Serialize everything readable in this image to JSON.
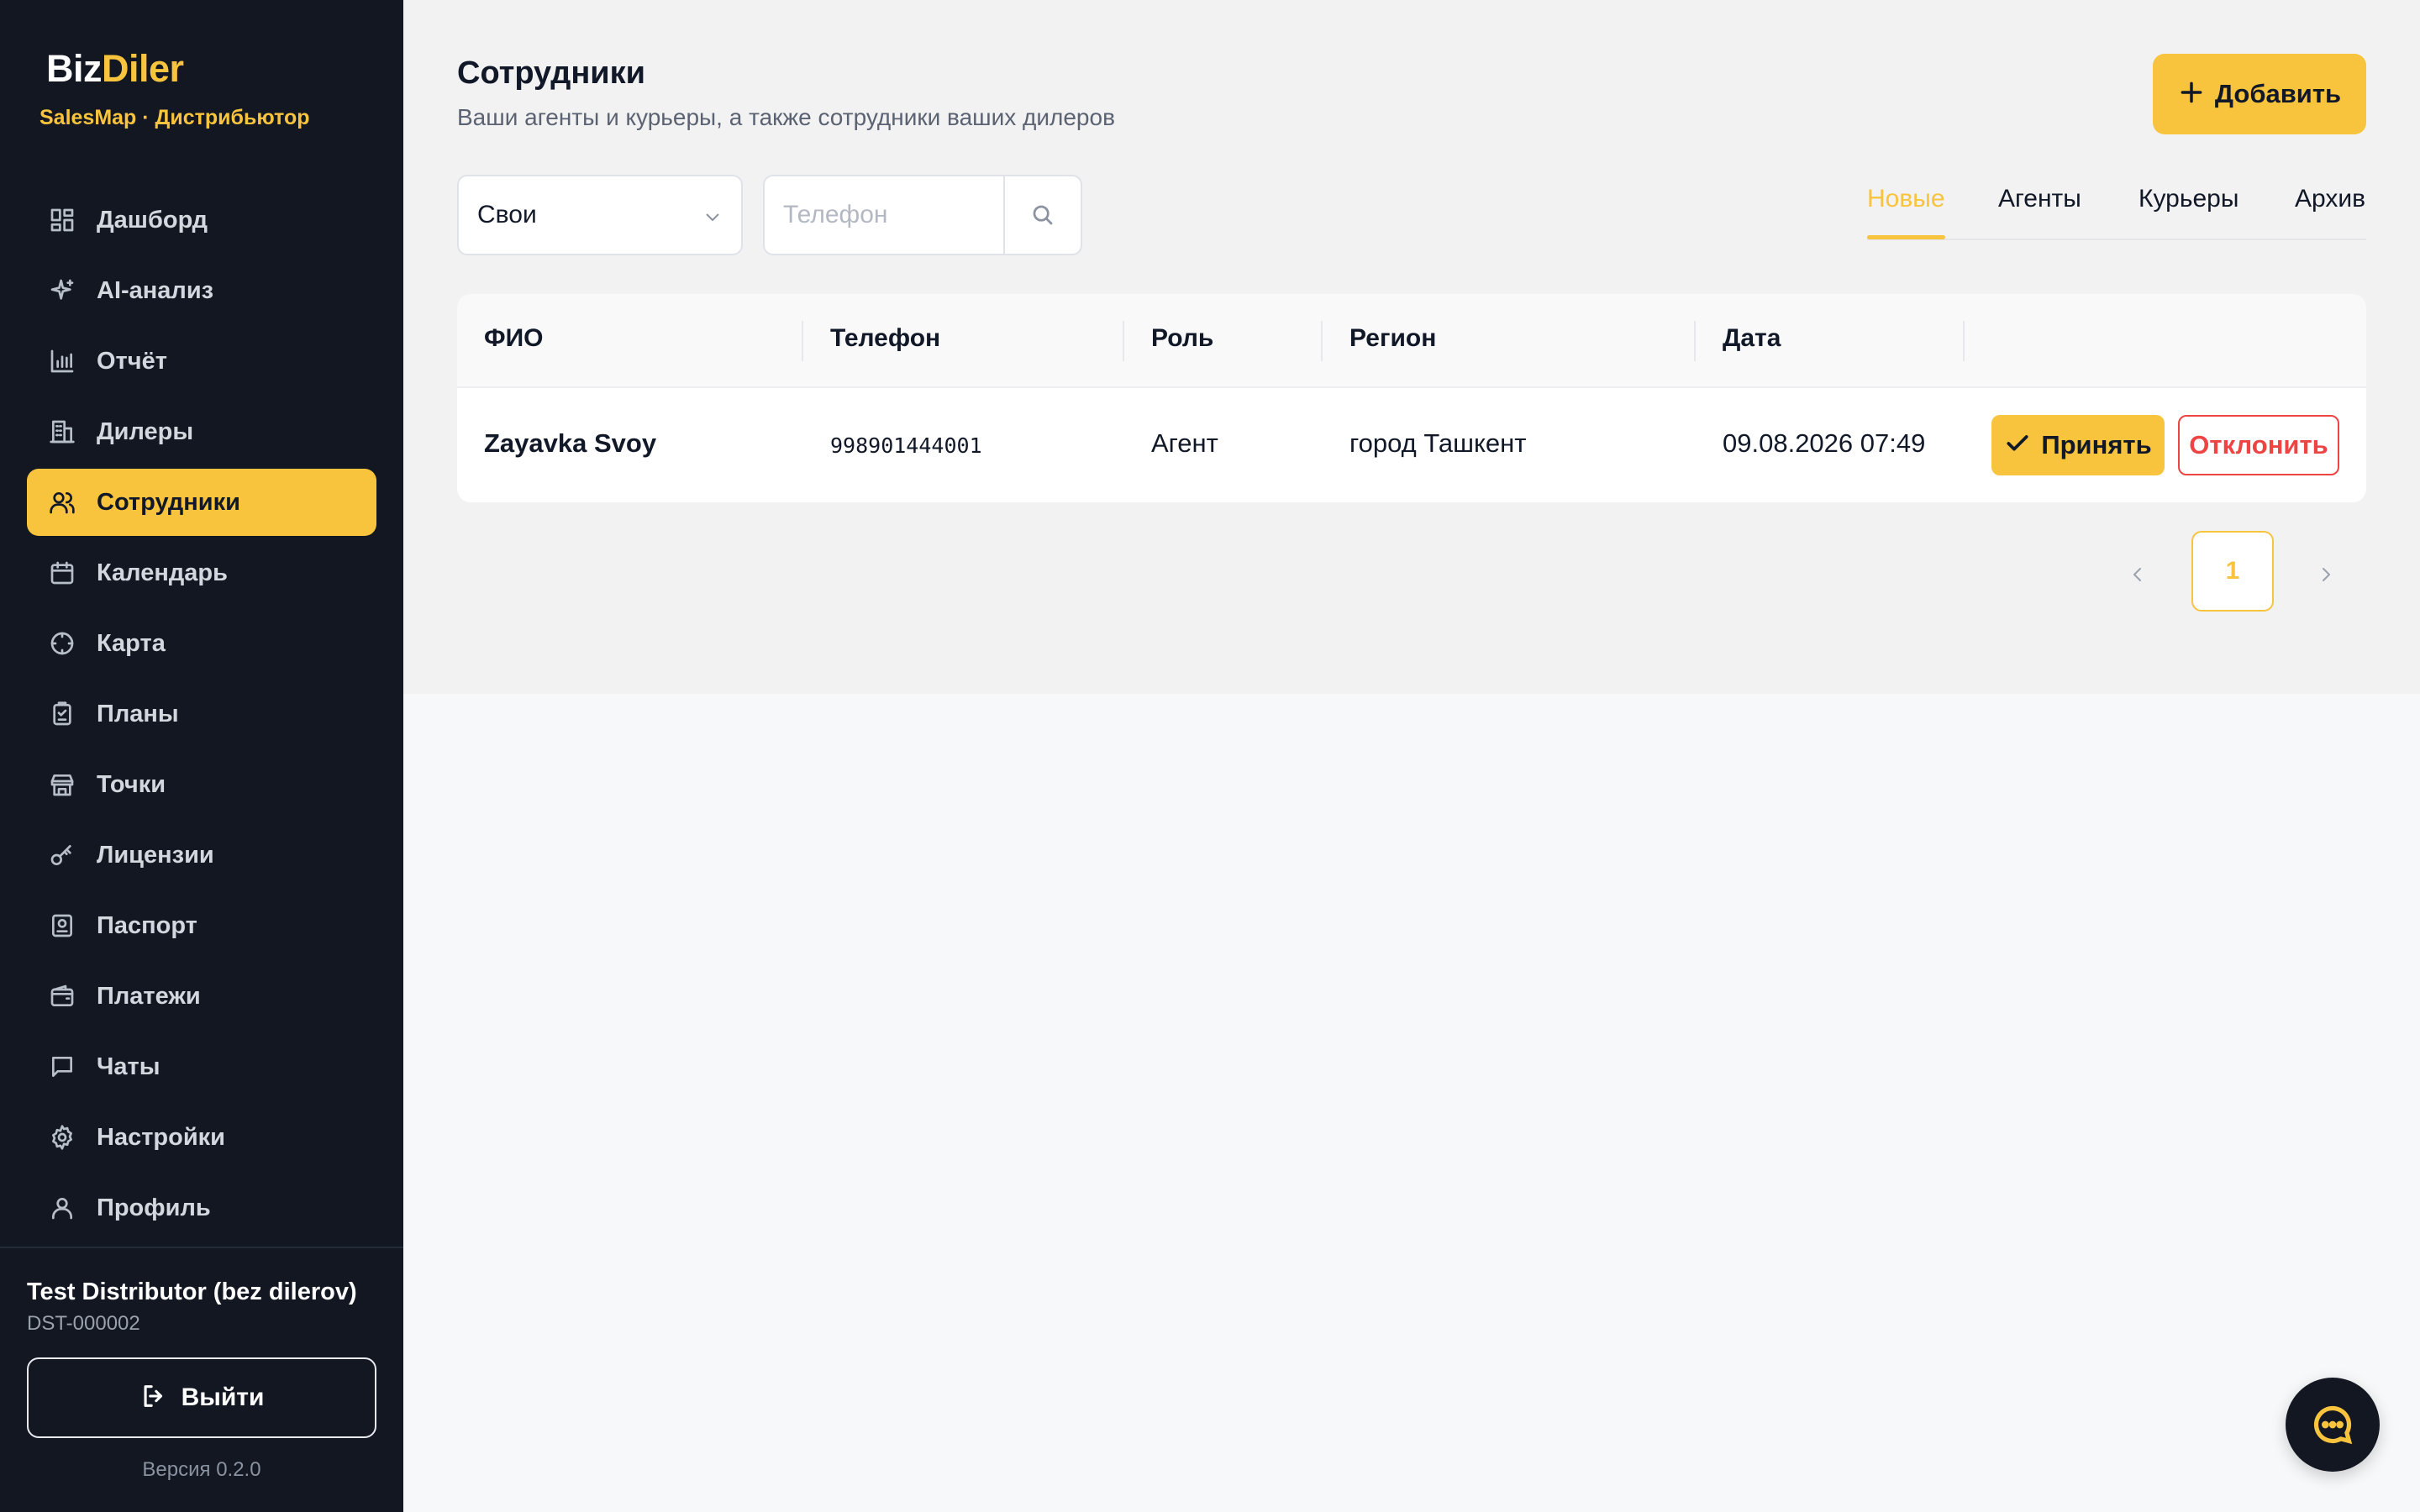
{
  "brand": {
    "part1": "Biz",
    "part2": "Diler",
    "subtitle": "SalesMap · Дистрибьютор"
  },
  "sidebar": {
    "items": [
      {
        "label": "Дашборд",
        "icon": "dashboard-icon"
      },
      {
        "label": "AI-анализ",
        "icon": "sparkle-icon"
      },
      {
        "label": "Отчёт",
        "icon": "bar-chart-icon"
      },
      {
        "label": "Дилеры",
        "icon": "building-icon"
      },
      {
        "label": "Сотрудники",
        "icon": "users-icon",
        "active": true
      },
      {
        "label": "Календарь",
        "icon": "calendar-icon"
      },
      {
        "label": "Карта",
        "icon": "crosshair-icon"
      },
      {
        "label": "Планы",
        "icon": "clipboard-icon"
      },
      {
        "label": "Точки",
        "icon": "store-icon"
      },
      {
        "label": "Лицензии",
        "icon": "key-icon"
      },
      {
        "label": "Паспорт",
        "icon": "id-card-icon"
      },
      {
        "label": "Платежи",
        "icon": "wallet-icon"
      },
      {
        "label": "Чаты",
        "icon": "chat-icon"
      },
      {
        "label": "Настройки",
        "icon": "gear-icon"
      },
      {
        "label": "Профиль",
        "icon": "user-icon"
      }
    ],
    "org_name": "Test Distributor (bez dilerov)",
    "org_code": "DST-000002",
    "logout_label": "Выйти",
    "version": "Версия 0.2.0"
  },
  "header": {
    "title": "Сотрудники",
    "subtitle": "Ваши агенты и курьеры, а также сотрудники ваших дилеров",
    "add_label": "Добавить"
  },
  "filters": {
    "scope_value": "Свои",
    "phone_placeholder": "Телефон",
    "phone_value": ""
  },
  "tabs": [
    {
      "label": "Новые",
      "active": true
    },
    {
      "label": "Агенты"
    },
    {
      "label": "Курьеры"
    },
    {
      "label": "Архив"
    }
  ],
  "table": {
    "columns": [
      "ФИО",
      "Телефон",
      "Роль",
      "Регион",
      "Дата"
    ],
    "rows": [
      {
        "name": "Zayavka Svoy",
        "phone": "998901444001",
        "role": "Агент",
        "region": "город Ташкент",
        "date": "09.08.2026 07:49"
      }
    ],
    "accept_label": "Принять",
    "reject_label": "Отклонить"
  },
  "pagination": {
    "current_page": "1"
  },
  "colors": {
    "accent": "#f9c43d",
    "sidebar_bg": "#121722",
    "danger": "#ef4444"
  }
}
